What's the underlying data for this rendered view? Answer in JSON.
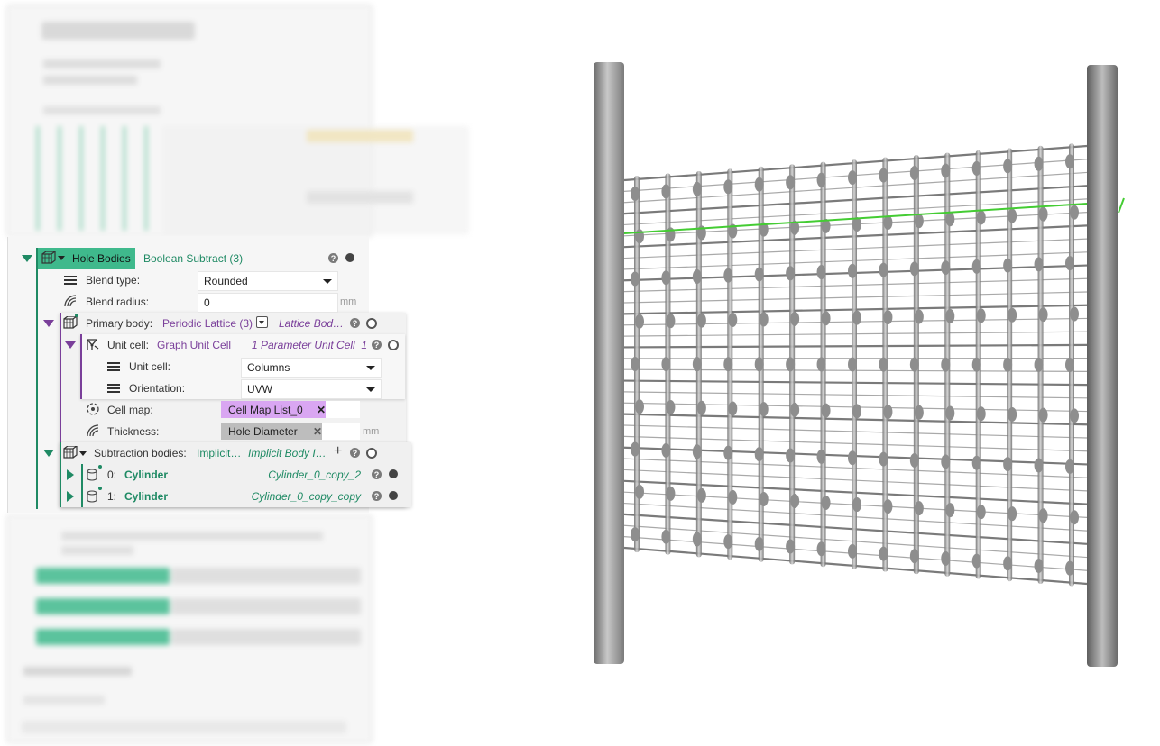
{
  "node": {
    "label": "Hole Bodies",
    "type": "Boolean Subtract (3)",
    "blend_type": {
      "label": "Blend type:",
      "value": "Rounded"
    },
    "blend_radius": {
      "label": "Blend radius:",
      "value": "0",
      "unit": "mm"
    },
    "primary_body": {
      "label": "Primary body:",
      "value": "Periodic Lattice (3)",
      "ref": "Lattice Bod…",
      "unit_cell_node": {
        "label": "Unit cell:",
        "value": "Graph Unit Cell",
        "ref": "1 Parameter Unit Cell_1"
      },
      "unit_cell": {
        "label": "Unit cell:",
        "value": "Columns"
      },
      "orientation": {
        "label": "Orientation:",
        "value": "UVW"
      },
      "cell_map": {
        "label": "Cell map:",
        "value": "Cell Map List_0"
      },
      "thickness": {
        "label": "Thickness:",
        "value": "Hole Diameter",
        "unit": "mm"
      }
    },
    "subtraction": {
      "label": "Subtraction bodies:",
      "value": "Implicit…",
      "ref": "Implicit Body I…",
      "items": [
        {
          "index": "0:",
          "type": "Cylinder",
          "name": "Cylinder_0_copy_2"
        },
        {
          "index": "1:",
          "type": "Cylinder",
          "name": "Cylinder_0_copy_copy"
        }
      ]
    }
  },
  "icons": [
    "help-icon",
    "bypass-dot-icon",
    "list-icon",
    "radius-icon",
    "lattice-icon",
    "unit-cell-icon",
    "cell-map-icon",
    "thickness-icon",
    "cylinder-icon",
    "close-icon",
    "plus-icon",
    "chevron-down-icon"
  ],
  "colors": {
    "accent_green": "#3fb98c",
    "dark_green": "#1f8a64",
    "purple": "#7a3f9a",
    "tag_purple": "#d9a6f2",
    "tag_gray": "#bdbdbd",
    "highlight_line": "#44cc33"
  }
}
